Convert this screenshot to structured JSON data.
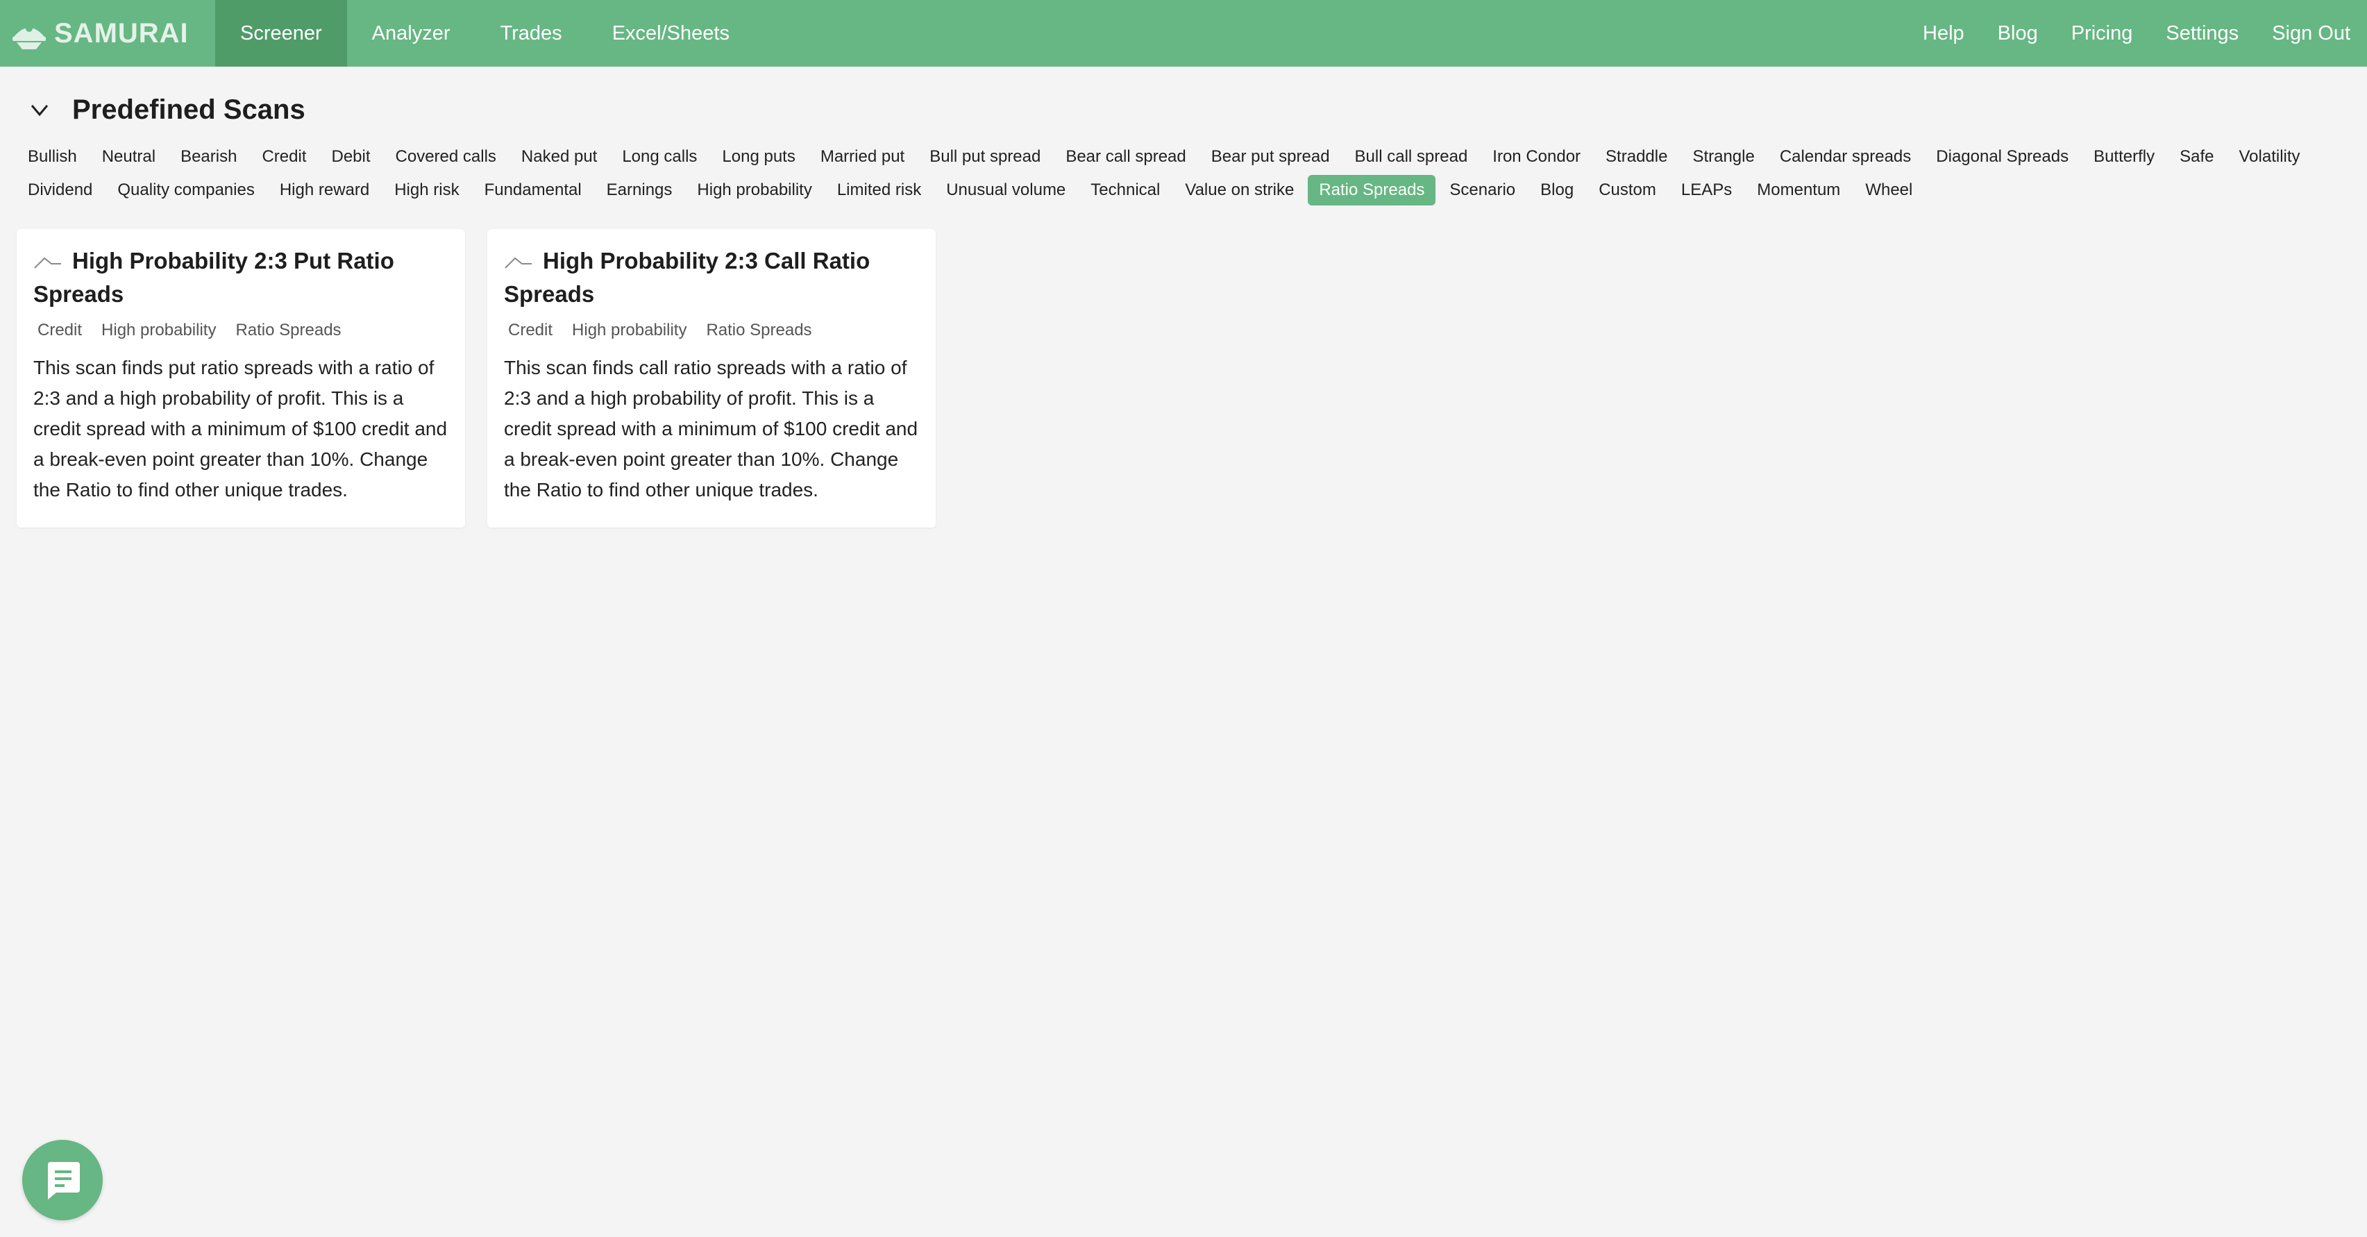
{
  "brand": {
    "name": "SAMURAI"
  },
  "nav": {
    "left": [
      "Screener",
      "Analyzer",
      "Trades",
      "Excel/Sheets"
    ],
    "right": [
      "Help",
      "Blog",
      "Pricing",
      "Settings",
      "Sign Out"
    ],
    "active": "Screener"
  },
  "section": {
    "title": "Predefined Scans"
  },
  "filters": [
    "Bullish",
    "Neutral",
    "Bearish",
    "Credit",
    "Debit",
    "Covered calls",
    "Naked put",
    "Long calls",
    "Long puts",
    "Married put",
    "Bull put spread",
    "Bear call spread",
    "Bear put spread",
    "Bull call spread",
    "Iron Condor",
    "Straddle",
    "Strangle",
    "Calendar spreads",
    "Diagonal Spreads",
    "Butterfly",
    "Safe",
    "Volatility",
    "Dividend",
    "Quality companies",
    "High reward",
    "High risk",
    "Fundamental",
    "Earnings",
    "High probability",
    "Limited risk",
    "Unusual volume",
    "Technical",
    "Value on strike",
    "Ratio Spreads",
    "Scenario",
    "Blog",
    "Custom",
    "LEAPs",
    "Momentum",
    "Wheel"
  ],
  "active_filter": "Ratio Spreads",
  "cards": [
    {
      "title": "High Probability 2:3 Put Ratio Spreads",
      "tags": [
        "Credit",
        "High probability",
        "Ratio Spreads"
      ],
      "description": "This scan finds put ratio spreads with a ratio of 2:3 and a high probability of profit. This is a credit spread with a minimum of $100 credit and a break-even point greater than 10%. Change the Ratio to find other unique trades."
    },
    {
      "title": "High Probability 2:3 Call Ratio Spreads",
      "tags": [
        "Credit",
        "High probability",
        "Ratio Spreads"
      ],
      "description": "This scan finds call ratio spreads with a ratio of 2:3 and a high probability of profit. This is a credit spread with a minimum of $100 credit and a break-even point greater than 10%. Change the Ratio to find other unique trades."
    }
  ],
  "colors": {
    "accent": "#66b783",
    "accent_dark": "#4f9c68",
    "background": "#f4f4f4"
  },
  "icons": {
    "logo": "samurai-helmet-icon",
    "collapse": "chevron-down-icon",
    "card": "chart-line-icon",
    "chat": "chat-icon"
  }
}
